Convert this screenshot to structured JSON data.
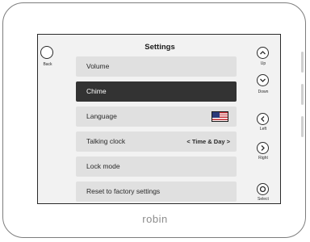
{
  "screen": {
    "title": "Settings",
    "back_label": "Back",
    "menu_items": [
      {
        "label": "Volume",
        "selected": false
      },
      {
        "label": "Chime",
        "selected": true
      },
      {
        "label": "Language",
        "selected": false,
        "value_icon": "us-flag-icon"
      },
      {
        "label": "Talking clock",
        "selected": false,
        "value": "< Time & Day >"
      },
      {
        "label": "Lock mode",
        "selected": false
      },
      {
        "label": "Reset to factory settings",
        "selected": false
      }
    ]
  },
  "hardware_buttons": {
    "up": "Up",
    "down": "Down",
    "left": "Left",
    "right": "Right",
    "select": "Select"
  },
  "brand": "robin",
  "colors": {
    "selected_item": "#333333",
    "item_background": "#e0e0e0",
    "screen_background": "#f2f2f2"
  }
}
